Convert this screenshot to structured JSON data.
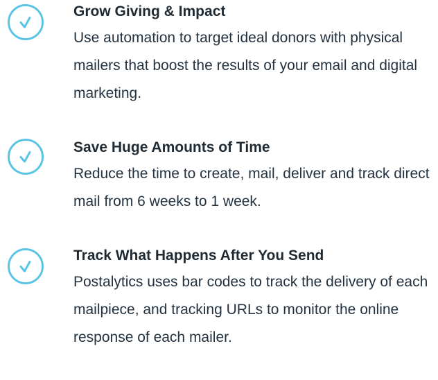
{
  "colors": {
    "accent": "#5bc3e4",
    "text": "#1f2a33"
  },
  "features": [
    {
      "icon": "check-circle-icon",
      "title": "Grow Giving & Impact",
      "description": "Use automation to target ideal donors with physical mailers that boost the results of your email and digital marketing."
    },
    {
      "icon": "check-circle-icon",
      "title": "Save Huge Amounts of Time",
      "description": "Reduce the time to create, mail, deliver and track direct mail from 6 weeks to 1 week."
    },
    {
      "icon": "check-circle-icon",
      "title": "Track What Happens After You Send",
      "description": "Postalytics uses bar codes to track the delivery of each mailpiece, and tracking URLs to monitor the online response of each mailer."
    }
  ]
}
